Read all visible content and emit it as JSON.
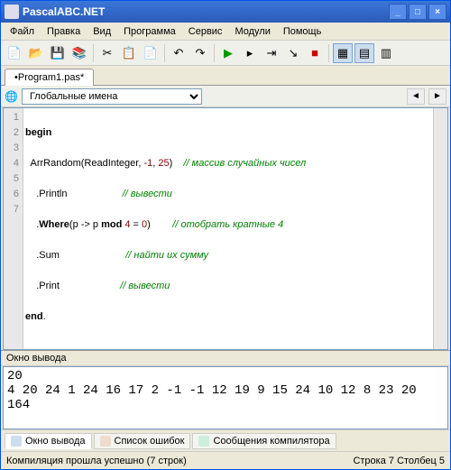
{
  "title": "PascalABC.NET",
  "menu": [
    "Файл",
    "Правка",
    "Вид",
    "Программа",
    "Сервис",
    "Модули",
    "Помощь"
  ],
  "tab": "•Program1.pas*",
  "dropdown": "Глобальные имена",
  "code": {
    "l1": "begin",
    "l2a": "  ArrRandom(ReadInteger, ",
    "l2n1": "-1",
    "l2s": ", ",
    "l2n2": "25",
    "l2b": ")    ",
    "l2c": "// массив случайных чисел",
    "l3a": "    .Println                    ",
    "l3c": "// вывести",
    "l4a": "    .",
    "l4w": "Where",
    "l4b": "(p -> p ",
    "l4m": "mod",
    "l4sp": " ",
    "l4n": "4",
    "l4s2": " = ",
    "l4n2": "0",
    "l4e": ")        ",
    "l4c": "// отобрать кратные 4",
    "l5a": "    .Sum                        ",
    "l5c": "// найти их сумму",
    "l6a": "    .Print                      ",
    "l6c": "// вывести",
    "l7": "end",
    "l7d": "."
  },
  "gutter": [
    "1",
    "2",
    "3",
    "4",
    "5",
    "6",
    "7"
  ],
  "output_title": "Окно вывода",
  "output": "20\n4 20 24 1 24 16 17 2 -1 -1 12 19 9 15 24 10 12 8 23 20\n164",
  "btabs": {
    "a": "Окно вывода",
    "b": "Список ошибок",
    "c": "Сообщения компилятора"
  },
  "status_left": "Компиляция прошла успешно (7 строк)",
  "status_right": "Строка  7 Столбец  5"
}
